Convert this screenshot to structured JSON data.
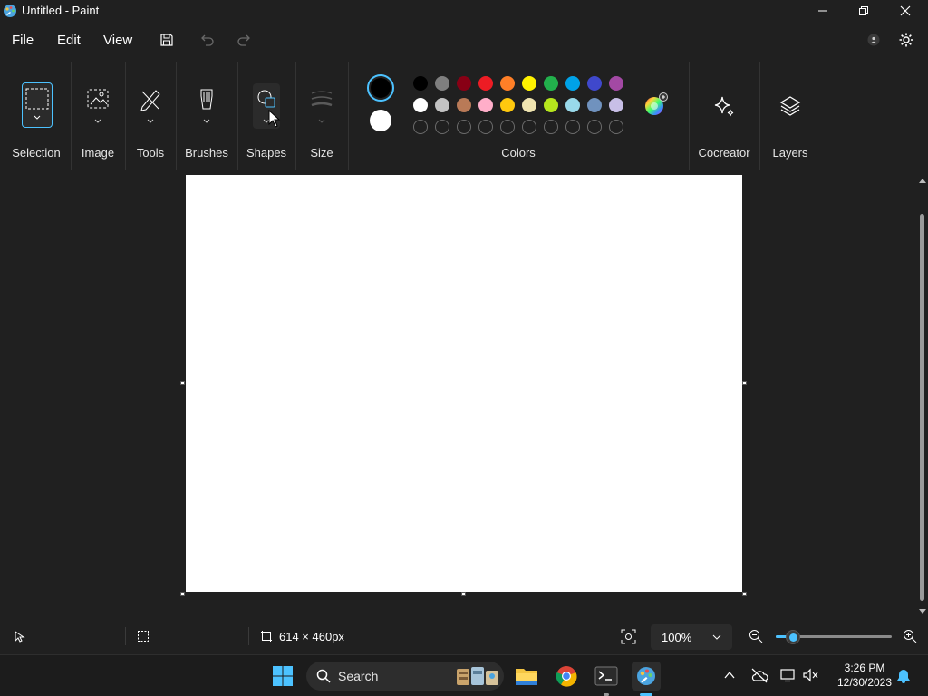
{
  "window": {
    "title": "Untitled - Paint"
  },
  "menu": {
    "file": "File",
    "edit": "Edit",
    "view": "View"
  },
  "ribbon": {
    "groups": {
      "selection": "Selection",
      "image": "Image",
      "tools": "Tools",
      "brushes": "Brushes",
      "shapes": "Shapes",
      "size": "Size",
      "colors": "Colors",
      "cocreator": "Cocreator",
      "layers": "Layers"
    },
    "primary_color": "#000000",
    "secondary_color": "#ffffff",
    "palette_row1": [
      "#000000",
      "#7f7f7f",
      "#880015",
      "#ed1c24",
      "#ff7f27",
      "#fff200",
      "#22b14c",
      "#00a2e8",
      "#3f48cc",
      "#a349a4"
    ],
    "palette_row2": [
      "#ffffff",
      "#c3c3c3",
      "#b97a57",
      "#ffaec9",
      "#ffc90e",
      "#efe4b0",
      "#b5e61d",
      "#99d9ea",
      "#7092be",
      "#c8bfe7"
    ],
    "palette_row3_count": 10
  },
  "status": {
    "canvas_size": "614 × 460px",
    "zoom": "100%",
    "zoom_fraction": 0.15
  },
  "taskbar": {
    "search_label": "Search",
    "time": "3:26 PM",
    "date": "12/30/2023"
  },
  "colors": {
    "accent": "#4cc2ff",
    "background": "#202020"
  }
}
